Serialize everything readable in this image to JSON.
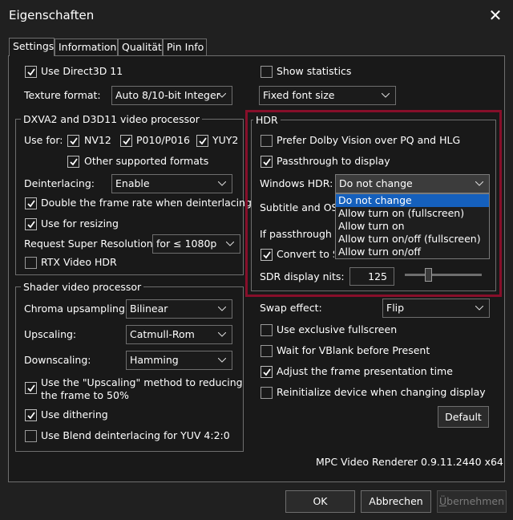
{
  "window": {
    "title": "Eigenschaften"
  },
  "tabs": [
    "Settings",
    "Information",
    "Qualität",
    "Pin Info"
  ],
  "left": {
    "use_d3d11": {
      "label": "Use Direct3D 11",
      "checked": true
    },
    "texture_format": {
      "label": "Texture format:",
      "value": "Auto 8/10-bit Integer"
    },
    "dxva_group": {
      "title": "DXVA2 and D3D11 video processor",
      "use_for_label": "Use for:",
      "nv12": {
        "label": "NV12",
        "checked": true
      },
      "p010": {
        "label": "P010/P016",
        "checked": true
      },
      "yuy2": {
        "label": "YUY2",
        "checked": true
      },
      "other_formats": {
        "label": "Other supported formats",
        "checked": true
      },
      "deinterlacing": {
        "label": "Deinterlacing:",
        "value": "Enable"
      },
      "double_frame_rate": {
        "label": "Double the frame rate when deinterlacing",
        "checked": true
      },
      "use_for_resizing": {
        "label": "Use for resizing",
        "checked": true
      },
      "super_resolution": {
        "label": "Request Super Resolution:",
        "value": "for ≤ 1080p"
      },
      "rtx_hdr": {
        "label": "RTX Video HDR",
        "checked": false
      }
    },
    "shader_group": {
      "title": "Shader video processor",
      "chroma": {
        "label": "Chroma upsampling:",
        "value": "Bilinear"
      },
      "upscaling": {
        "label": "Upscaling:",
        "value": "Catmull-Rom"
      },
      "downscaling": {
        "label": "Downscaling:",
        "value": "Hamming"
      },
      "upscaling_method": {
        "label_line1": "Use the \"Upscaling\" method to reducing",
        "label_line2": "the frame to 50%",
        "checked": true
      },
      "dithering": {
        "label": "Use dithering",
        "checked": true
      },
      "blend_deint": {
        "label": "Use Blend deinterlacing for YUV 4:2:0",
        "checked": false
      }
    }
  },
  "right": {
    "show_statistics": {
      "label": "Show statistics",
      "checked": false
    },
    "font_size": {
      "value": "Fixed font size"
    },
    "hdr_group": {
      "title": "HDR",
      "prefer_dolby": {
        "label": "Prefer Dolby Vision over PQ and HLG",
        "checked": false
      },
      "passthrough": {
        "label": "Passthrough to display",
        "checked": true
      },
      "windows_hdr": {
        "label": "Windows HDR:",
        "value": "Do not change"
      },
      "subtitle_osd": {
        "label": "Subtitle and OSD"
      },
      "if_passthrough": {
        "label": "If passthrough is"
      },
      "convert_to_sdr": {
        "label": "Convert to SDR",
        "checked": true
      },
      "sdr_nits": {
        "label": "SDR display nits:",
        "value": "125",
        "slider_fraction": 0.3
      }
    },
    "windows_hdr_options": [
      "Do not change",
      "Allow turn on (fullscreen)",
      "Allow turn on",
      "Allow turn on/off (fullscreen)",
      "Allow turn on/off"
    ],
    "swap_effect": {
      "label": "Swap effect:",
      "value": "Flip"
    },
    "exclusive_fullscreen": {
      "label": "Use exclusive fullscreen",
      "checked": false
    },
    "wait_vblank": {
      "label": "Wait for VBlank before Present",
      "checked": false
    },
    "adjust_frame_time": {
      "label": "Adjust the frame presentation time",
      "checked": true
    },
    "reinit_device": {
      "label": "Reinitialize device when changing display",
      "checked": false
    },
    "default_button": "Default",
    "version": "MPC Video Renderer 0.9.11.2440 x64"
  },
  "buttons": {
    "ok": "OK",
    "cancel": "Abbrechen",
    "apply_prefix": "Ü",
    "apply_rest": "bernehmen"
  }
}
